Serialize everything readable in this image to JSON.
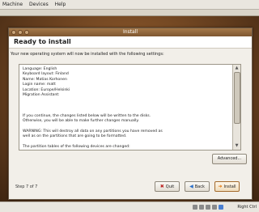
{
  "host_menu": [
    "Machine",
    "Devices",
    "Help"
  ],
  "window": {
    "title": "Install",
    "heading": "Ready to install",
    "description": "Your new operating system will now be installed with the following settings:",
    "summary_lines": [
      "Language: English",
      "Keyboard layout: Finland",
      "Name: Matias Korhonen",
      "Login name: matt",
      "Location: Europe/Helsinki",
      "Migration Assistant:",
      "",
      "",
      "",
      "If you continue, the changes listed below will be written to the disks.",
      "Otherwise, you will be able to make further changes manually.",
      "",
      "WARNING: This will destroy all data on any partitions you have removed as",
      "well as on the partitions that are going to be formatted.",
      "",
      "The partition tables of the following devices are changed:"
    ],
    "advanced_label": "Advanced...",
    "step_text": "Step 7 of 7",
    "buttons": {
      "quit": "Quit",
      "back": "Back",
      "install": "Install"
    }
  },
  "host_status": {
    "host_key": "Right Ctrl"
  },
  "colors": {
    "title_bar": "#8f6538",
    "desktop": "#7a4b24",
    "window_bg": "#f2efe9"
  },
  "icons": {
    "quit": "quit-icon",
    "back": "back-arrow-icon",
    "install": "install-arrow-icon"
  }
}
